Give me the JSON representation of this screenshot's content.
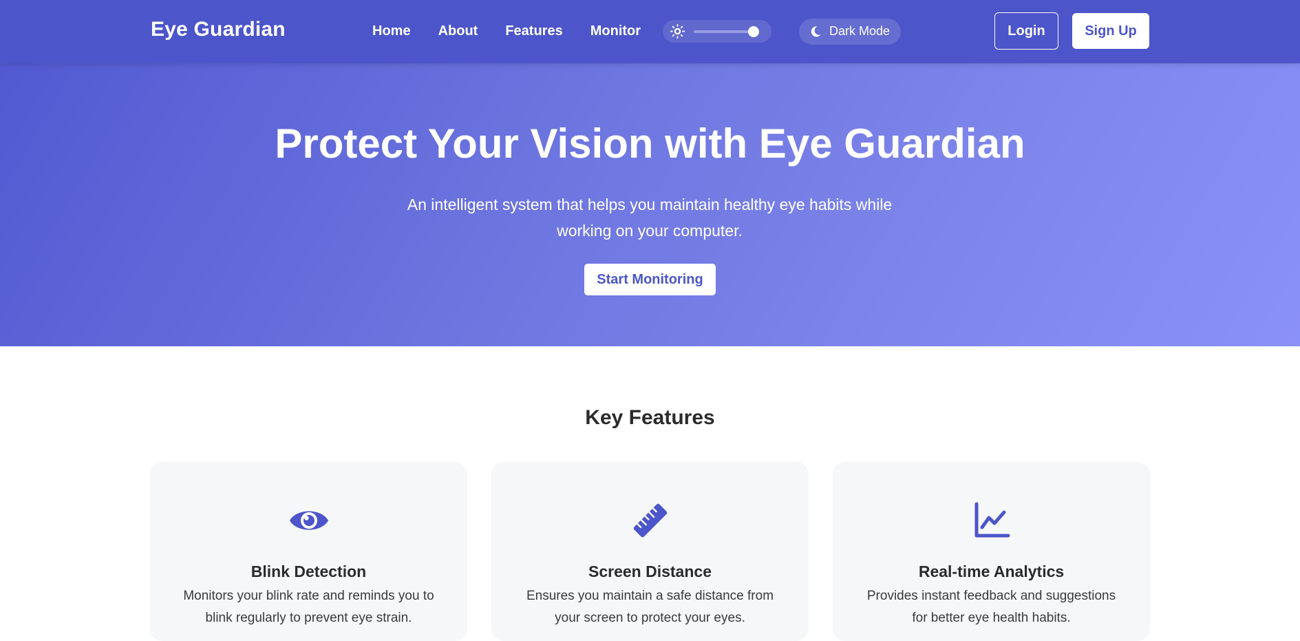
{
  "navbar": {
    "brand": "Eye Guardian",
    "links": [
      {
        "label": "Home"
      },
      {
        "label": "About"
      },
      {
        "label": "Features"
      },
      {
        "label": "Monitor"
      }
    ],
    "brightness": {
      "icon": "sun-icon",
      "level": 0.9
    },
    "dark_mode": {
      "icon": "moon-icon",
      "label": "Dark Mode"
    },
    "login_label": "Login",
    "signup_label": "Sign Up"
  },
  "hero": {
    "title": "Protect Your Vision with Eye Guardian",
    "subtitle": "An intelligent system that helps you maintain healthy eye habits while working on your computer.",
    "cta_label": "Start Monitoring"
  },
  "features": {
    "heading": "Key Features",
    "cards": [
      {
        "icon": "eye-icon",
        "title": "Blink Detection",
        "description": "Monitors your blink rate and reminds you to blink regularly to prevent eye strain."
      },
      {
        "icon": "ruler-icon",
        "title": "Screen Distance",
        "description": "Ensures you maintain a safe distance from your screen to protect your eyes."
      },
      {
        "icon": "chart-line-icon",
        "title": "Real-time Analytics",
        "description": "Provides instant feedback and suggestions for better eye health habits."
      }
    ]
  },
  "colors": {
    "primary": "#4c55c9",
    "hero_gradient_start": "#525ad2",
    "hero_gradient_end": "#8a91f7",
    "card_background": "#f6f7f9"
  }
}
